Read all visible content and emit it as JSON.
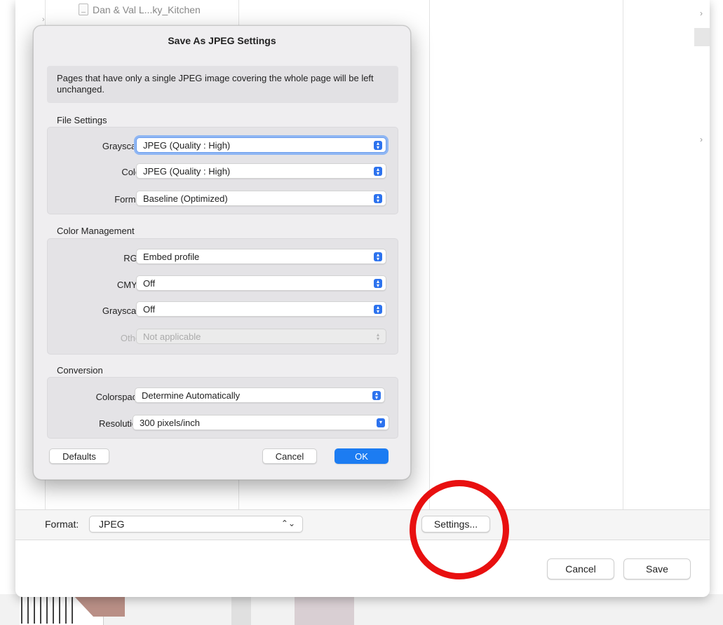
{
  "background_file": {
    "name": "Dan & Val L...ky_Kitchen"
  },
  "dialog": {
    "title": "Save As JPEG Settings",
    "info": "Pages that have only a single JPEG image covering the whole page will be left unchanged.",
    "file_settings": {
      "title": "File Settings",
      "grayscale": {
        "label": "Grayscale:",
        "value": "JPEG (Quality : High)"
      },
      "color": {
        "label": "Color:",
        "value": "JPEG (Quality : High)"
      },
      "format": {
        "label": "Format:",
        "value": "Baseline (Optimized)"
      }
    },
    "color_management": {
      "title": "Color Management",
      "rgb": {
        "label": "RGB:",
        "value": "Embed profile"
      },
      "cmyk": {
        "label": "CMYK:",
        "value": "Off"
      },
      "grayscale": {
        "label": "Grayscale:",
        "value": "Off"
      },
      "other": {
        "label": "Other:",
        "value": "Not applicable"
      }
    },
    "conversion": {
      "title": "Conversion",
      "colorspace": {
        "label": "Colorspace:",
        "value": "Determine Automatically"
      },
      "resolution": {
        "label": "Resolution:",
        "value": "300 pixels/inch"
      }
    },
    "buttons": {
      "defaults": "Defaults",
      "cancel": "Cancel",
      "ok": "OK"
    }
  },
  "save_panel": {
    "format_label": "Format:",
    "format_value": "JPEG",
    "settings_button": "Settings...",
    "cancel_button": "Cancel",
    "save_button": "Save"
  },
  "icons": {
    "stepper": "up-down-arrows-icon",
    "dropdown": "chevron-down-icon",
    "file": "document-icon"
  },
  "colors": {
    "accent": "#1c7cf2",
    "highlight_circle": "#e81010"
  }
}
